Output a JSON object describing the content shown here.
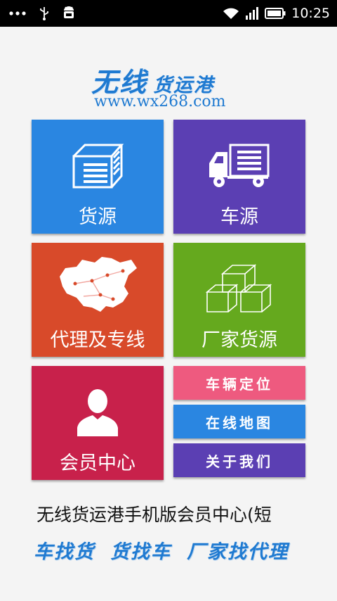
{
  "status_bar": {
    "time": "10:25",
    "left_icons": [
      "more-dots-icon",
      "usb-icon",
      "android-debug-icon"
    ],
    "right_icons": [
      "wifi-icon",
      "signal-icon",
      "battery-icon"
    ]
  },
  "logo": {
    "title_main": "无线",
    "title_sub": "货运港",
    "url": "www.wx268.com",
    "color": "#1f7ad1"
  },
  "tiles": {
    "goods": {
      "label": "货源",
      "icon": "cargo-box-icon",
      "color": "#2a86e1"
    },
    "trucks": {
      "label": "车源",
      "icon": "truck-icon",
      "color": "#5b3fb3"
    },
    "agent": {
      "label": "代理及专线",
      "icon": "china-map-icon",
      "color": "#d84a2a"
    },
    "factory": {
      "label": "厂家货源",
      "icon": "boxes-icon",
      "color": "#65a91e"
    },
    "member": {
      "label": "会员中心",
      "icon": "user-silhouette-icon",
      "color": "#c8214b"
    },
    "vehicle_location": {
      "label": "车辆定位",
      "color": "#ee5a7f"
    },
    "online_map": {
      "label": "在线地图",
      "color": "#2a86e1"
    },
    "about_us": {
      "label": "关于我们",
      "color": "#5b3fb3"
    }
  },
  "marquee": {
    "text": "无线货运港手机版会员中心(短"
  },
  "slogan": {
    "items": [
      "车找货",
      "货找车",
      "厂家找代理"
    ]
  }
}
